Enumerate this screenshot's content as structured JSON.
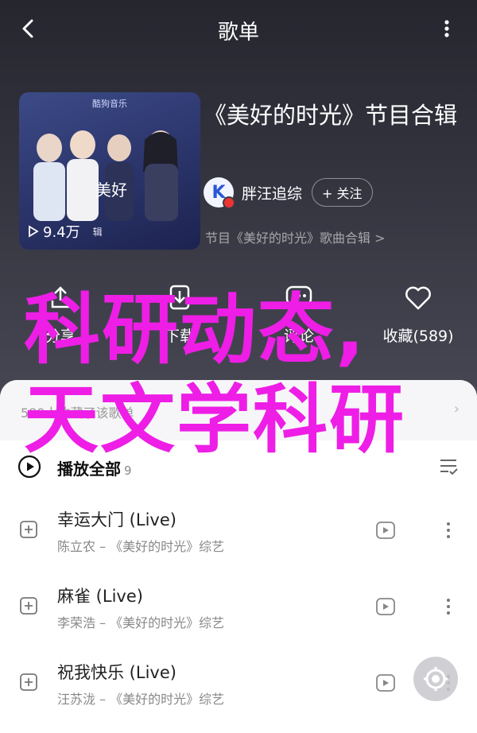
{
  "header": {
    "title": "歌单"
  },
  "cover": {
    "brand": "酷狗音乐",
    "plays": "9.4万",
    "plays_extra": "辑"
  },
  "album": {
    "title": "《美好的时光》节目合辑",
    "owner_name": "胖汪追综",
    "follow_label": "+ 关注",
    "collection_link": "节目《美好的时光》歌曲合辑 >"
  },
  "actions": [
    {
      "label": "分享",
      "icon": "share-icon"
    },
    {
      "label": "下载",
      "icon": "download-icon"
    },
    {
      "label": "评论",
      "icon": "comment-icon"
    },
    {
      "label": "收藏(589)",
      "icon": "heart-icon"
    }
  ],
  "description": {
    "text": "589人收藏了该歌单"
  },
  "play_all": {
    "label": "播放全部",
    "count": "9"
  },
  "songs": [
    {
      "title": "幸运大门 (Live)",
      "subtitle": "陈立农 – 《美好的时光》综艺"
    },
    {
      "title": "麻雀 (Live)",
      "subtitle": "李荣浩 – 《美好的时光》综艺"
    },
    {
      "title": "祝我快乐 (Live)",
      "subtitle": "汪苏泷 – 《美好的时光》综艺"
    }
  ],
  "overlay": {
    "line1": "科研动态,",
    "line2": "天文学科研"
  },
  "colors": {
    "overlay": "#ee1ee6",
    "background": "#2a2a34"
  }
}
